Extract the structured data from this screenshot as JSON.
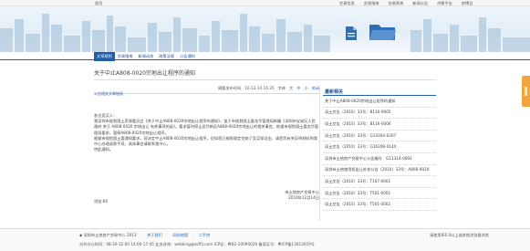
{
  "topbar": {
    "home": "首页",
    "links": [
      "交易信息",
      "交易指南",
      "交易系统",
      "新闻公告",
      "供需平台",
      "房博会"
    ]
  },
  "banner": {
    "icons": [
      "document-icon",
      "folder-icon"
    ]
  },
  "mainnav": {
    "items": [
      "文章规则",
      "交易指南",
      "新闻动态",
      "政策法规",
      "公告通知"
    ],
    "active_index": 0
  },
  "page": {
    "title": "关于中止A808-0020宗地出让程序的通知"
  },
  "article_meta": {
    "breadcrumb": "公告相关文章链接",
    "date_label": "摘要发布时间",
    "date_value": "10-12-14 16:35",
    "font_label": "字体",
    "font_large": "大",
    "font_mid": "中",
    "font_small": "小",
    "close": "关闭"
  },
  "article": {
    "heading_line": "关于中止A808-0020宗地出让程序的通知",
    "greeting": "各位竞买人：",
    "paragraphs": [
      "我深圳市规划国土资源委员会《关于中止A808-0020宗地出让程序的通知》，鉴于市规划国土委龙华管理局新编《深圳市宝安区人民政府 关于 A808-0020 宗地出让 有关事项的函》。要求暂时停止龙华新区A808-0020宗地出让的相关事宜，依据市规划国土委龙华管理局要求，暂停A808-0020宗地出让程序。",
      "根据市规划国土委通知要求，现决定中止A808-0020宗地出让程序，但如您已按照规定交纳了竞买保证金，请您凭有关证明材料到我中心办理退款手续，具体事宜请联系我中心。",
      "特此通知。"
    ],
    "signature": "市土地房产交易中心",
    "sign_date": "2010年12月14日",
    "views": "浏览:60"
  },
  "sidebar": {
    "title": "最新相关",
    "items": [
      "关于中止A808-0020宗地出让程序的通知",
      "深土交告（2010）33号：B116-0005",
      "深土交告（2010）33号：B116-0006",
      "深土交告（2010）33号：G14304-0207",
      "深土交告（2010）33号：G16308-0144",
      "深圳市土地房产交易中心公告编号：G11314-0092",
      "深圳市土地使用权出让补充公告（2010）33号：A808-0020",
      "深土交告（2010）33号：T107-0001",
      "深土交告（2010）33号：T501-0001",
      "深土交告（2010）33号：T501-0002"
    ]
  },
  "footer": {
    "copyright": "◆ 深圳市土地房产交易中心 2013",
    "links": [
      "关于我们",
      "网站地图",
      "二手房"
    ],
    "browser_tip": "请使用IE6.0以上或其他浏览器浏览",
    "contact": "对外办公时间：08:30-12:00 14:00-17:45  业务咨询：webking@zsff3.com  ICP证：粤B2-20090029 备案证号：粤ICP备13053059号"
  },
  "colors": {
    "accent": "#1f5fa8",
    "link": "#2a64b4",
    "side_tab": "#f0a540"
  }
}
